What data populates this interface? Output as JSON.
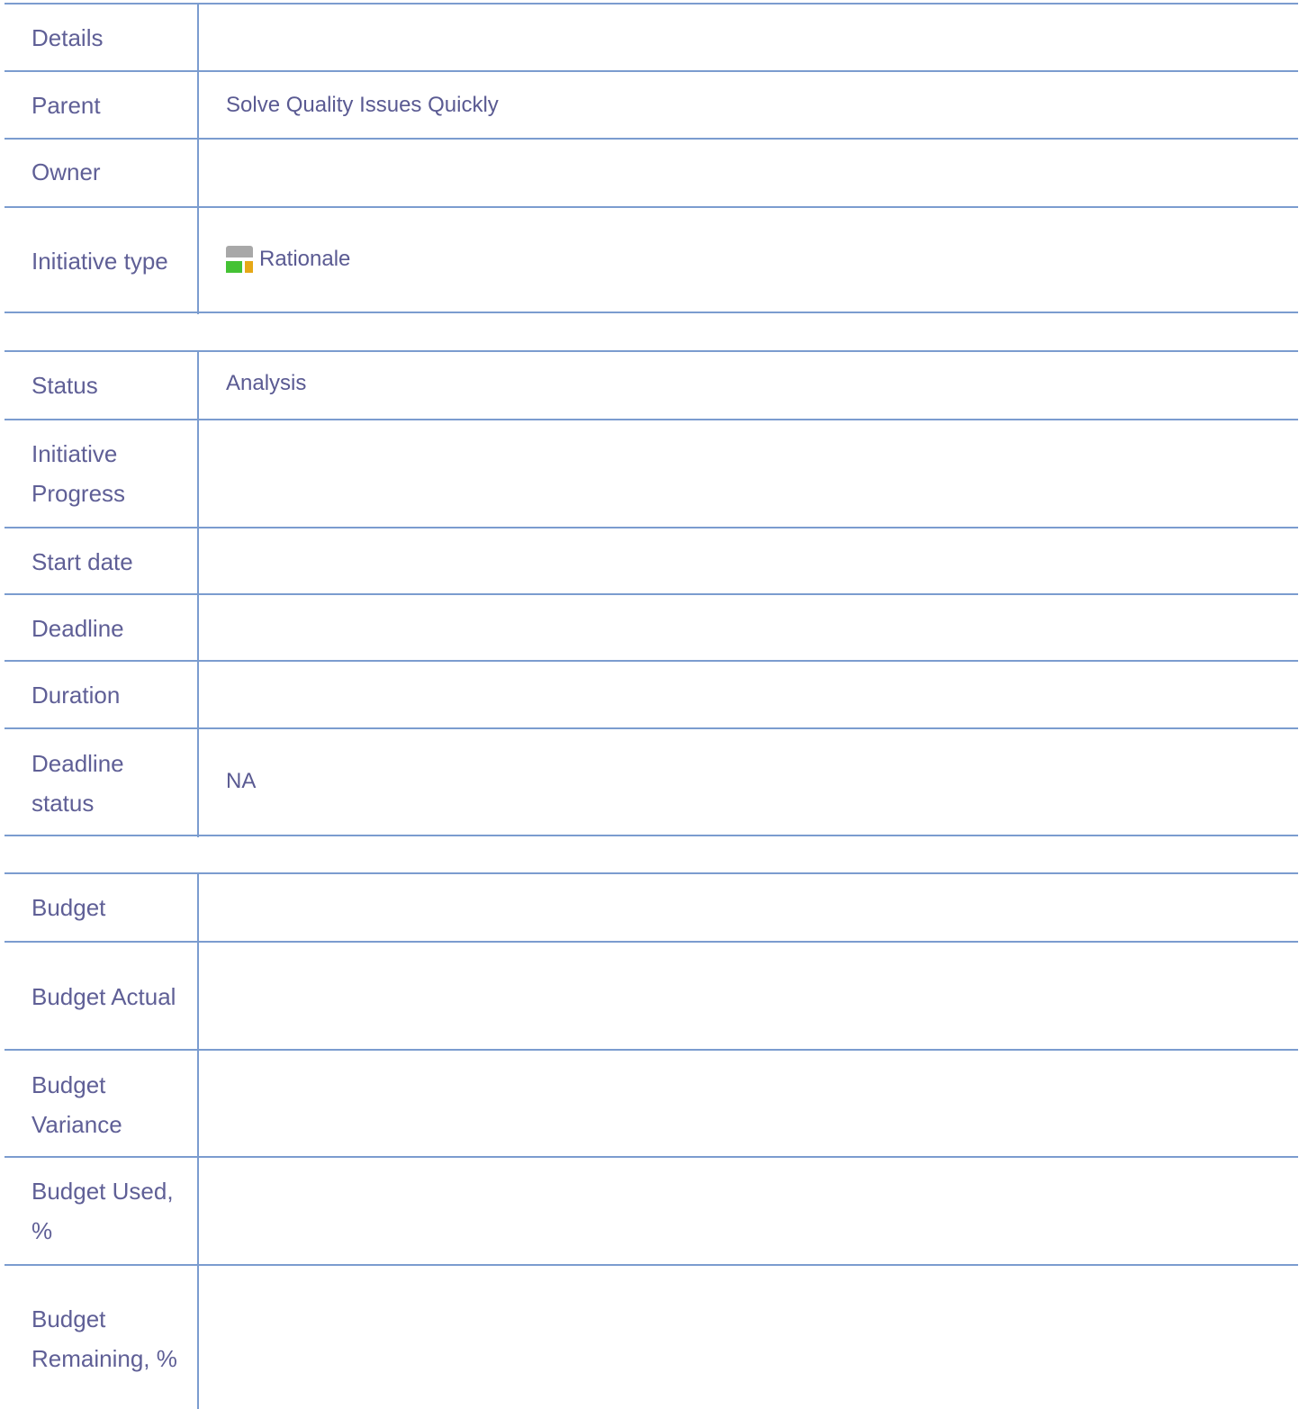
{
  "sections": [
    {
      "rows": [
        {
          "label": "Details",
          "value": ""
        },
        {
          "label": "Parent",
          "value": "Solve Quality Issues Quickly"
        },
        {
          "label": "Owner",
          "value": ""
        },
        {
          "label": "Initiative type",
          "value": "Rationale",
          "icon": "initiative-type-icon"
        }
      ]
    },
    {
      "rows": [
        {
          "label": "Status",
          "value": "Analysis"
        },
        {
          "label": "Initiative Progress",
          "value": ""
        },
        {
          "label": "Start date",
          "value": ""
        },
        {
          "label": "Deadline",
          "value": ""
        },
        {
          "label": "Duration",
          "value": ""
        },
        {
          "label": "Deadline status",
          "value": "NA"
        }
      ]
    },
    {
      "rows": [
        {
          "label": "Budget",
          "value": ""
        },
        {
          "label": "Budget Actual",
          "value": ""
        },
        {
          "label": "Budget Variance",
          "value": ""
        },
        {
          "label": "Budget Used, %",
          "value": ""
        },
        {
          "label": "Budget Remaining, %",
          "value": ""
        }
      ]
    }
  ],
  "colors": {
    "border": "#7b9ccf",
    "text": "#5f5f96",
    "icon_gray": "#a8a8a8",
    "icon_green": "#44c234",
    "icon_orange": "#e6a817"
  }
}
